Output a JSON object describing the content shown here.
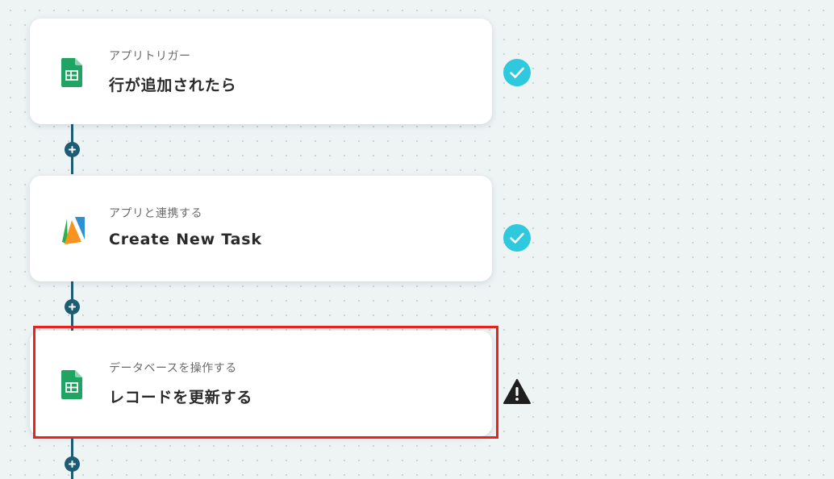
{
  "workflow": {
    "steps": [
      {
        "type_label": "アプリトリガー",
        "title": "行が追加されたら",
        "app_icon": "google-sheets-icon",
        "status": "completed",
        "status_icon": "check-circle-icon"
      },
      {
        "type_label": "アプリと連携する",
        "title": "Create New Task",
        "app_icon": "asana-style-app-icon",
        "status": "completed",
        "status_icon": "check-circle-icon"
      },
      {
        "type_label": "データベースを操作する",
        "title": "レコードを更新する",
        "app_icon": "google-sheets-icon",
        "status": "warning",
        "status_icon": "warning-triangle-icon",
        "highlighted": true
      }
    ],
    "add_step_icon": "plus-icon"
  },
  "colors": {
    "connector": "#1e5c73",
    "check": "#2ec9dc",
    "warning": "#1f1f1f",
    "highlight_border": "#e8231f",
    "sheets_green": "#1fa463"
  }
}
